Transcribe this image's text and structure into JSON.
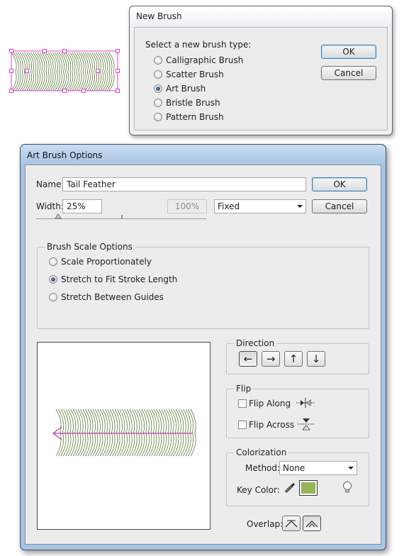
{
  "new_brush": {
    "title": "New Brush",
    "prompt": "Select a new brush type:",
    "types": [
      {
        "label": "Calligraphic Brush",
        "selected": false
      },
      {
        "label": "Scatter Brush",
        "selected": false
      },
      {
        "label": "Art Brush",
        "selected": true
      },
      {
        "label": "Bristle Brush",
        "selected": false
      },
      {
        "label": "Pattern Brush",
        "selected": false
      }
    ],
    "ok_label": "OK",
    "cancel_label": "Cancel"
  },
  "art_brush": {
    "title": "Art Brush Options",
    "name_label": "Name:",
    "name_value": "Tail Feather",
    "width_label": "Width:",
    "width_value": "25%",
    "width_max": "100%",
    "width_mode": "Fixed",
    "ok_label": "OK",
    "cancel_label": "Cancel",
    "scale_group": {
      "title": "Brush Scale Options",
      "options": [
        {
          "label": "Scale Proportionately",
          "selected": false
        },
        {
          "label": "Stretch to Fit Stroke Length",
          "selected": true
        },
        {
          "label": "Stretch Between Guides",
          "selected": false
        }
      ]
    },
    "direction_group": {
      "title": "Direction",
      "buttons": [
        {
          "icon": "arrow-left-icon",
          "glyph": "←",
          "pressed": true
        },
        {
          "icon": "arrow-right-icon",
          "glyph": "→",
          "pressed": false
        },
        {
          "icon": "arrow-up-icon",
          "glyph": "↑",
          "pressed": false
        },
        {
          "icon": "arrow-down-icon",
          "glyph": "↓",
          "pressed": false
        }
      ]
    },
    "flip_group": {
      "title": "Flip",
      "flip_along_label": "Flip Along",
      "flip_across_label": "Flip Across",
      "flip_along_checked": false,
      "flip_across_checked": false
    },
    "colorization_group": {
      "title": "Colorization",
      "method_label": "Method:",
      "method_value": "None",
      "key_color_label": "Key Color:",
      "key_color": "#96b45a"
    },
    "overlap_label": "Overlap:"
  },
  "colors": {
    "feather_stroke": "#5c7a3a",
    "selection": "#e040d0",
    "path": "#c03aa8"
  }
}
